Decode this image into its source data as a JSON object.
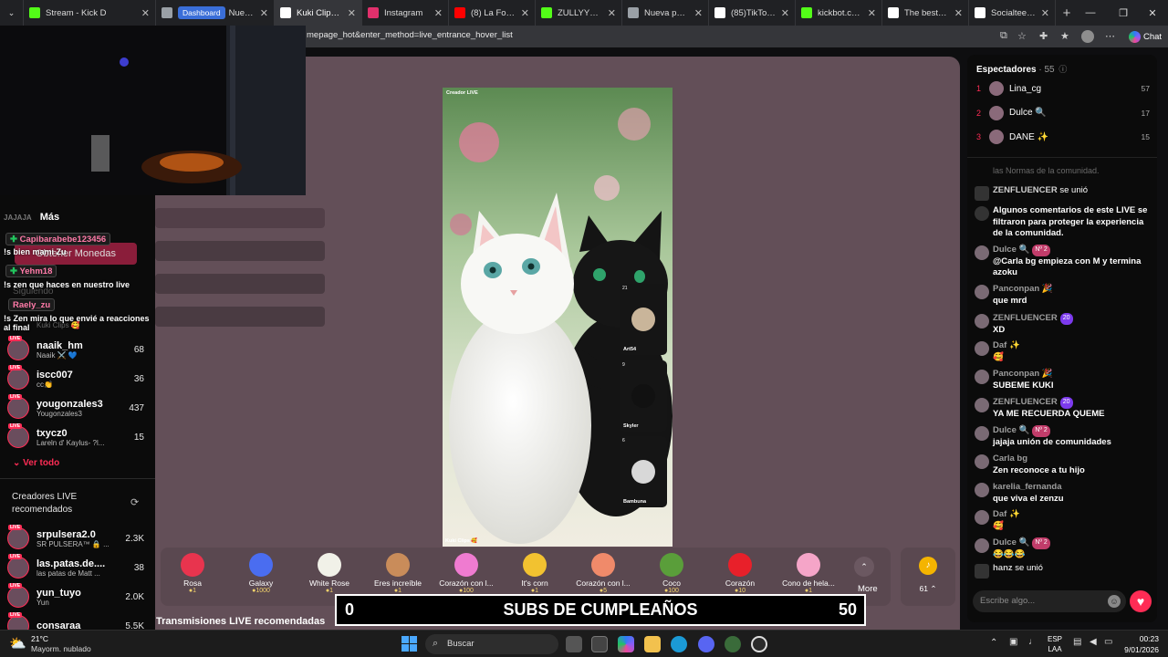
{
  "browser": {
    "tabs": [
      {
        "label": "Stream - Kick D",
        "icon": "kick",
        "color": "#53fc18"
      },
      {
        "label": "Nueva pestaña",
        "icon": "page",
        "color": "#9aa0a6",
        "badge": "Dashboard"
      },
      {
        "label": "Kuki Clips 🥰",
        "icon": "tiktok",
        "color": "#ffffff",
        "active": true
      },
      {
        "label": "Instagram",
        "icon": "instagram",
        "color": "#e1306c"
      },
      {
        "label": "(8) La Forma En",
        "icon": "youtube",
        "color": "#ff0000"
      },
      {
        "label": "ZULLYY_CS Strea",
        "icon": "kick",
        "color": "#53fc18"
      },
      {
        "label": "Nueva pestaña",
        "icon": "page",
        "color": "#9aa0a6"
      },
      {
        "label": "(85)TikTok - Mal",
        "icon": "tiktok",
        "color": "#ffffff"
      },
      {
        "label": "kickbot.com/da",
        "icon": "kick",
        "color": "#53fc18"
      },
      {
        "label": "The best ChatB",
        "icon": "chatbot",
        "color": "#ffffff"
      },
      {
        "label": "Socialteen SOC",
        "icon": "page",
        "color": "#ffffff"
      }
    ],
    "url": "mepage_hot&enter_method=live_entrance_hover_list",
    "chat_label": "Chat"
  },
  "sidebar": {
    "more_label": "Más",
    "ghost_label_1": "JAJAJA",
    "ghost_label_2": "Obtener Monedas",
    "ghost_label_3": "Siguiendo",
    "ghost_label_4": "Kuki Clips 🥰",
    "chat_overlay": [
      {
        "user": "Capibarabebe123456",
        "message": "!s bien mami Zu"
      },
      {
        "user": "Yehm18",
        "message": "!s zen que haces en nuestro live"
      },
      {
        "user": "Raely_zu",
        "message": "!s Zen mira lo que envié a reacciones al final"
      }
    ],
    "following": [
      {
        "name": "naaik_hm",
        "sub": "Naaik ⚔️ 💙",
        "count": "68"
      },
      {
        "name": "iscc007",
        "sub": "cc👏",
        "count": "36"
      },
      {
        "name": "yougonzales3",
        "sub": "Yougonzales3",
        "count": "437"
      },
      {
        "name": "txycz0",
        "sub": "Lareln d' Kaylus- ?l...",
        "count": "15"
      }
    ],
    "see_all": "Ver todo",
    "recommended_title": "Creadores LIVE recomendados",
    "recommended": [
      {
        "name": "srpulsera2.0",
        "sub": "SR PULSERA™ 🔒 ...",
        "count": "2.3K"
      },
      {
        "name": "las.patas.de....",
        "sub": "las patas de Matt ...",
        "count": "38"
      },
      {
        "name": "yun_tuyo",
        "sub": "Yun",
        "count": "2.0K"
      },
      {
        "name": "consaraa",
        "sub": "",
        "count": "5.5K"
      }
    ]
  },
  "player": {
    "creator_tag": "Creador LIVE",
    "watermark": "Kuki Clips 🥰",
    "guests": [
      {
        "name": "Art54",
        "count": "21"
      },
      {
        "name": "Skyler",
        "count": "9"
      },
      {
        "name": "Bambuna",
        "count": "6"
      }
    ]
  },
  "gifts": {
    "items": [
      {
        "name": "Rosa",
        "price": "1",
        "color": "#e8344e"
      },
      {
        "name": "Galaxy",
        "price": "1000",
        "color": "#4a6df0"
      },
      {
        "name": "White Rose",
        "price": "1",
        "color": "#f1f1e8"
      },
      {
        "name": "Eres increíble",
        "price": "1",
        "color": "#c98c5a"
      },
      {
        "name": "Corazón con l...",
        "price": "100",
        "color": "#ef7bd0"
      },
      {
        "name": "It's corn",
        "price": "1",
        "color": "#f2c230"
      },
      {
        "name": "Corazón con l...",
        "price": "5",
        "color": "#f08a6a"
      },
      {
        "name": "Coco",
        "price": "100",
        "color": "#5a9e3a"
      },
      {
        "name": "Corazón",
        "price": "10",
        "color": "#e8202a"
      },
      {
        "name": "Cono de hela...",
        "price": "1",
        "color": "#f5a5c8"
      }
    ],
    "more_label": "More",
    "coins": "61"
  },
  "banner": {
    "left": "0",
    "title": "SUBS DE CUMPLEAÑOS",
    "right": "50"
  },
  "recommended_lives_title": "Transmisiones LIVE recomendadas",
  "right_panel": {
    "viewers_title": "Espectadores",
    "viewers_count": "· 55",
    "top_viewers": [
      {
        "rank": "1",
        "name": "Lina_cg",
        "score": "57"
      },
      {
        "rank": "2",
        "name": "Dulce 🔍",
        "score": "17"
      },
      {
        "rank": "3",
        "name": "DANE ✨",
        "score": "15"
      }
    ],
    "comments": [
      {
        "user": "",
        "text": "las Normas de la comunidad.",
        "kind": "faded"
      },
      {
        "user": "ZENFLUENCER",
        "text": "se unió",
        "kind": "join"
      },
      {
        "user": "",
        "text": "Algunos comentarios de este LIVE se filtraron para proteger la experiencia de la comunidad.",
        "kind": "system"
      },
      {
        "user": "Dulce 🔍",
        "badge": "Nº 2",
        "text": "@Carla bg empieza con M y termina azoku",
        "kind": "msg"
      },
      {
        "user": "Panconpan 🎉",
        "text": "que mrd",
        "kind": "msg"
      },
      {
        "user": "ZENFLUENCER",
        "badge": "20",
        "text": "XD",
        "kind": "msg"
      },
      {
        "user": "Daf ✨",
        "text": "🥰",
        "kind": "msg"
      },
      {
        "user": "Panconpan 🎉",
        "text": "SUBEME KUKI",
        "kind": "msg"
      },
      {
        "user": "ZENFLUENCER",
        "badge": "20",
        "text": "YA ME RECUERDA QUEME",
        "kind": "msg"
      },
      {
        "user": "Dulce 🔍",
        "badge": "Nº 2",
        "text": "jajaja unión de comunidades",
        "kind": "msg"
      },
      {
        "user": "Carla bg",
        "text": "Zen reconoce a tu hijo",
        "kind": "msg"
      },
      {
        "user": "karelia_fernanda",
        "text": "que viva el zenzu",
        "kind": "msg"
      },
      {
        "user": "Daf ✨",
        "text": "🥰",
        "kind": "msg"
      },
      {
        "user": "Dulce 🔍",
        "badge": "Nº 2",
        "text": "😂😂😂",
        "kind": "msg"
      },
      {
        "user": "hanz",
        "text": "se unió",
        "kind": "join"
      }
    ],
    "input_placeholder": "Escribe algo..."
  },
  "taskbar": {
    "weather_temp": "21°C",
    "weather_desc": "Mayorm. nublado",
    "search_placeholder": "Buscar",
    "lang": "ESP",
    "lang_sub": "LAA",
    "time": "00:23",
    "date": "9/01/2026"
  }
}
